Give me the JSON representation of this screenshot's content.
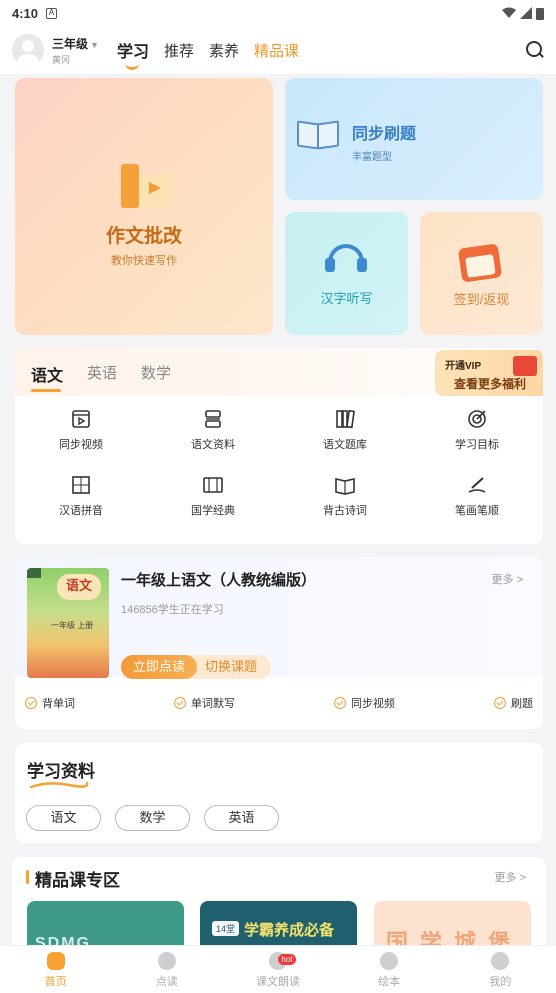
{
  "status_bar": {
    "time": "4:10",
    "notification_icon": "A"
  },
  "header": {
    "grade": "三年级",
    "sub": "黄冈",
    "tabs": [
      "学习",
      "推荐",
      "素养",
      "精品课"
    ],
    "active_tab": "学习"
  },
  "features": {
    "zuowen": {
      "title": "作文批改",
      "sub": "教你快速写作"
    },
    "tongbu": {
      "title": "同步刷题",
      "sub": "丰富题型"
    },
    "hanzi": {
      "title": "汉字听写"
    },
    "qiandao": {
      "title": "签到/返现"
    }
  },
  "subjects": {
    "tabs": [
      "语文",
      "英语",
      "数学"
    ],
    "active": "语文",
    "vip": {
      "line1": "开通VIP",
      "line2": "查看更多福利"
    },
    "items": [
      {
        "label": "同步视频",
        "icon": "video-icon"
      },
      {
        "label": "语文资料",
        "icon": "stack-icon"
      },
      {
        "label": "语文题库",
        "icon": "library-icon"
      },
      {
        "label": "学习目标",
        "icon": "target-icon"
      },
      {
        "label": "汉语拼音",
        "icon": "pinyin-icon"
      },
      {
        "label": "国学经典",
        "icon": "classics-icon"
      },
      {
        "label": "背古诗词",
        "icon": "poem-icon"
      },
      {
        "label": "笔画笔顺",
        "icon": "pen-icon"
      }
    ]
  },
  "course": {
    "cover_badge": "语文",
    "cover_label": "一年级 上册",
    "title": "一年级上语文（人教统编版）",
    "more": "更多 >",
    "count": "146856学生正在学习",
    "read_button": "立即点读",
    "switch_button": "切换课题",
    "actions": [
      "背单词",
      "单词默写",
      "同步视频",
      "刷题"
    ]
  },
  "materials": {
    "title": "学习资料",
    "pills": [
      "语文",
      "数学",
      "英语"
    ]
  },
  "premium": {
    "title": "精品课专区",
    "more": "更多 >",
    "thumbs": [
      {
        "text": "SDMG"
      },
      {
        "tag": "14堂",
        "text": "学霸养成必备"
      },
      {
        "text": "国学城堡"
      }
    ]
  },
  "bottom_nav": {
    "items": [
      {
        "label": "首页",
        "active": true
      },
      {
        "label": "点读",
        "active": false
      },
      {
        "label": "课文朗读",
        "active": false,
        "badge": "hot"
      },
      {
        "label": "绘本",
        "active": false
      },
      {
        "label": "我的",
        "active": false
      }
    ]
  },
  "colors": {
    "accent": "#f7a133",
    "blue": "#3a7fc4",
    "teal": "#1fa0b3"
  }
}
